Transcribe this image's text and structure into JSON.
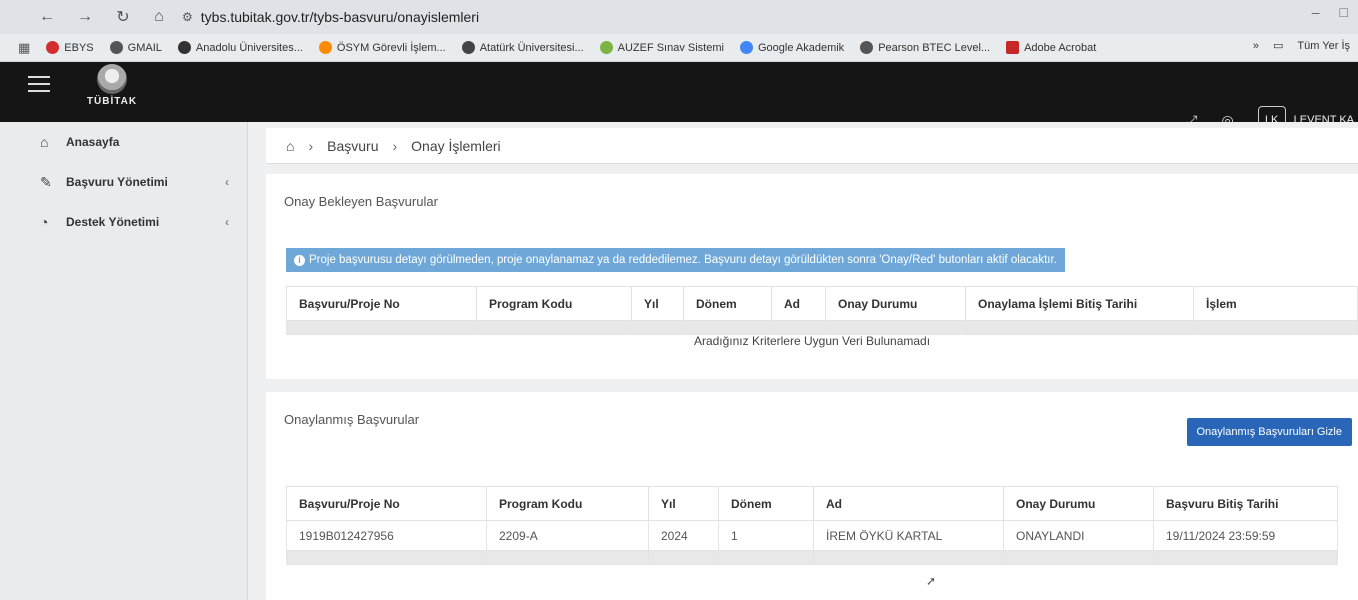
{
  "browser": {
    "url": "tybs.tubitak.gov.tr/tybs-basvuru/onayislemleri",
    "bookmarks": [
      {
        "label": "EBYS",
        "color": "#d32f2f"
      },
      {
        "label": "GMAIL",
        "color": "#555555"
      },
      {
        "label": "Anadolu Üniversites...",
        "color": "#333333"
      },
      {
        "label": "ÖSYM Görevli İşlem...",
        "color": "#ff8c00"
      },
      {
        "label": "Atatürk Üniversitesi...",
        "color": "#444444"
      },
      {
        "label": "AUZEF Sınav Sistemi",
        "color": "#7cb342"
      },
      {
        "label": "Google Akademik",
        "color": "#4285f4"
      },
      {
        "label": "Pearson BTEC Level...",
        "color": "#555555"
      },
      {
        "label": "Adobe Acrobat",
        "color": "#c62828"
      }
    ],
    "all_bookmarks": "Tüm Yer İş"
  },
  "header": {
    "logo_text": "TÜBİTAK",
    "user_initials": "LK",
    "user_name": "LEVENT KA"
  },
  "sidebar": {
    "items": [
      {
        "label": "Anasayfa",
        "icon": "home-icon"
      },
      {
        "label": "Başvuru Yönetimi",
        "icon": "pencil-icon"
      },
      {
        "label": "Destek Yönetimi",
        "icon": "pie-chart-icon"
      }
    ]
  },
  "breadcrumb": {
    "items": [
      "Başvuru",
      "Onay İşlemleri"
    ]
  },
  "pending": {
    "title": "Onay Bekleyen Başvurular",
    "alert": "Proje başvurusu detayı görülmeden, proje onaylanamaz ya da reddedilemez. Başvuru detayı görüldükten sonra 'Onay/Red' butonları aktif olacaktır.",
    "columns": [
      "Başvuru/Proje No",
      "Program Kodu",
      "Yıl",
      "Dönem",
      "Ad",
      "Onay Durumu",
      "Onaylama İşlemi Bitiş Tarihi",
      "İşlem"
    ],
    "empty_message": "Aradığınız Kriterlere Uygun Veri Bulunamadı"
  },
  "approved": {
    "title": "Onaylanmış Başvurular",
    "hide_button": "Onaylanmış Başvuruları Gizle",
    "columns": [
      "Başvuru/Proje No",
      "Program Kodu",
      "Yıl",
      "Dönem",
      "Ad",
      "Onay Durumu",
      "Başvuru Bitiş Tarihi"
    ],
    "rows": [
      [
        "1919B012427956",
        "2209-A",
        "2024",
        "1",
        "İREM ÖYKÜ KARTAL",
        "ONAYLANDI",
        "19/11/2024 23:59:59"
      ]
    ]
  }
}
